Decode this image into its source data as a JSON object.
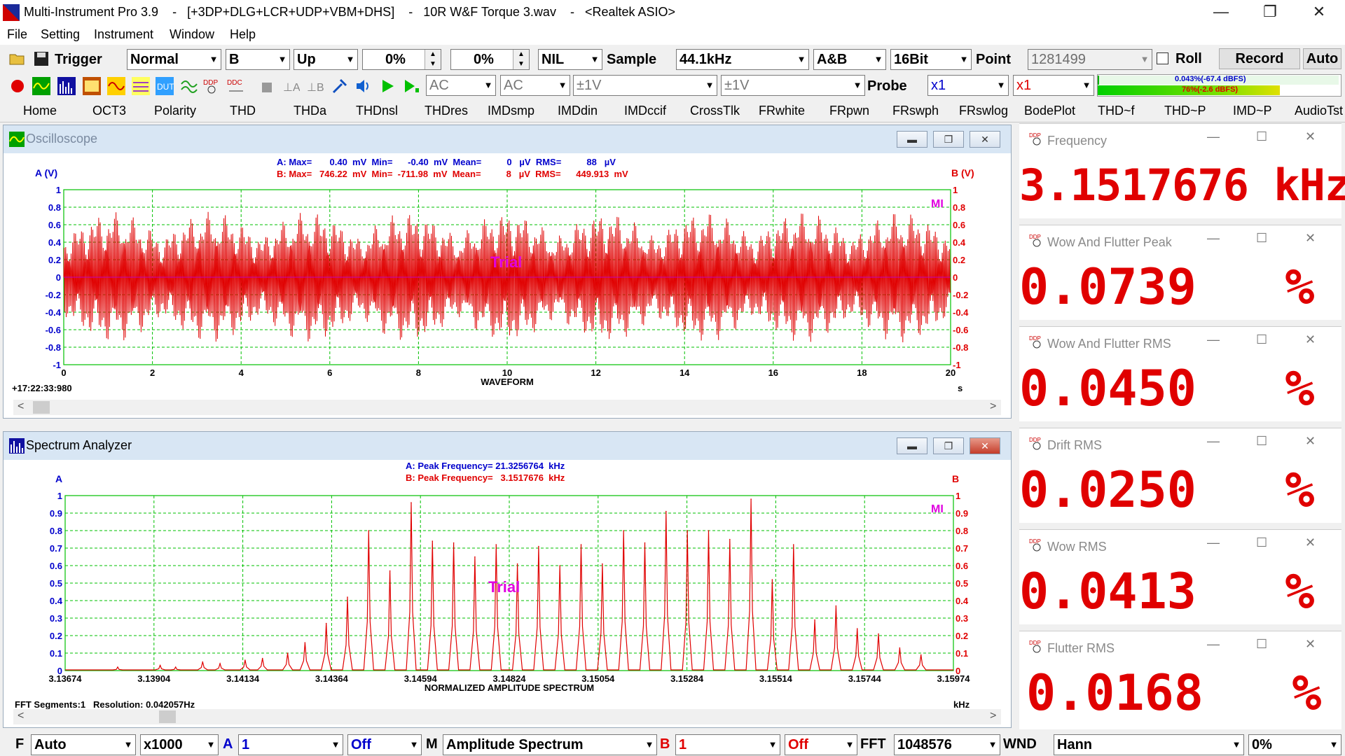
{
  "window": {
    "title": "Multi-Instrument Pro 3.9    -   [+3DP+DLG+LCR+UDP+VBM+DHS]    -   10R W&F Torque 3.wav    -   <Realtek ASIO>",
    "minimize": "—",
    "restore": "❐",
    "close": "✕"
  },
  "menu": [
    "File",
    "Setting",
    "Instrument",
    "Window",
    "Help"
  ],
  "toolbar1": {
    "trigger_label": "Trigger",
    "trigger_mode": "Normal",
    "trigger_channel": "B",
    "trigger_edge": "Up",
    "trigger_level": "0%",
    "trigger_delay": "0%",
    "nil": "NIL",
    "sample_label": "Sample",
    "sample_rate": "44.1kHz",
    "channels": "A&B",
    "bits": "16Bit",
    "point_label": "Point",
    "points": "1281499",
    "roll_label": "Roll",
    "record_label": "Record",
    "auto_label": "Auto"
  },
  "toolbar2": {
    "coupling_a": "AC",
    "coupling_b": "AC",
    "range_a": "±1V",
    "range_b": "±1V",
    "probe_label": "Probe",
    "probe_a": "x1",
    "probe_b": "x1",
    "level_a": "0.043%(-67.4 dBFS)",
    "level_b": "76%(-2.6 dBFS)"
  },
  "tabs": [
    "Home",
    "OCT3",
    "Polarity",
    "THD",
    "THDa",
    "THDnsl",
    "THDres",
    "IMDsmp",
    "IMDdin",
    "IMDccif",
    "CrossTlk",
    "FRwhite",
    "FRpwn",
    "FRswph",
    "FRswlog",
    "BodePlot",
    "THD~f",
    "THD~P",
    "IMD~P",
    "AudioTst"
  ],
  "oscilloscope": {
    "title": "Oscilloscope",
    "stats_a": "A: Max=       0.40  mV  Min=      -0.40  mV  Mean=          0   µV  RMS=          88   µV",
    "stats_b": "B: Max=   746.22  mV  Min=  -711.98  mV  Mean=          8   µV  RMS=      449.913  mV",
    "left_axis": "A (V)",
    "right_axis": "B (V)",
    "timestamp": "+17:22:33:980",
    "x_unit": "s",
    "watermark": "Trial",
    "mi_logo": "MI"
  },
  "spectrum": {
    "title": "Spectrum Analyzer",
    "peak_a": "A: Peak Frequency= 21.3256764  kHz",
    "peak_b": "B: Peak Frequency=   3.1517676  kHz",
    "left_axis": "A",
    "right_axis": "B",
    "x_unit": "kHz",
    "fft_info": "FFT Segments:1   Resolution: 0.042057Hz",
    "watermark": "Trial",
    "mi_logo": "MI"
  },
  "meters": [
    {
      "title": "Frequency",
      "value": "3.1517676 kHz"
    },
    {
      "title": "Wow And Flutter Peak",
      "value": "0.0739   %"
    },
    {
      "title": "Wow And Flutter RMS",
      "value": "0.0450   %"
    },
    {
      "title": "Drift RMS",
      "value": "0.0250   %"
    },
    {
      "title": "Wow RMS",
      "value": "0.0413   %"
    },
    {
      "title": "Flutter RMS",
      "value": "0.0168   %"
    }
  ],
  "bottombar": {
    "f_label": "F",
    "f_mode": "Auto",
    "zoom": "x1000",
    "a_label": "A",
    "a_value": "1",
    "a_state": "Off",
    "m_label": "M",
    "m_mode": "Amplitude Spectrum",
    "b_label": "B",
    "b_value": "1",
    "b_state": "Off",
    "fft_label": "FFT",
    "fft_size": "1048576",
    "wnd_label": "WND",
    "window_func": "Hann",
    "overlap": "0%"
  },
  "colors": {
    "trace": "#e00000",
    "grid": "#00c000",
    "a_text": "#0000cc",
    "b_text": "#e00000",
    "watermark": "#e000e0"
  },
  "chart_data": [
    {
      "type": "line",
      "xlabel": "WAVEFORM",
      "ylabel": "A (V)",
      "x_ticks": [
        "0",
        "2",
        "4",
        "6",
        "8",
        "10",
        "12",
        "14",
        "16",
        "18",
        "20"
      ],
      "y_ticks": [
        "1",
        "0.8",
        "0.6",
        "0.4",
        "0.2",
        "0",
        "-0.2",
        "-0.4",
        "-0.6",
        "-0.8",
        "-1"
      ],
      "xlim": [
        0,
        20
      ],
      "ylim": [
        -1,
        1
      ],
      "grid": true,
      "series": [
        {
          "name": "B",
          "peak_amplitude": 0.75,
          "envelope_min_amplitude": 0.15,
          "envelope_periods": 9
        }
      ]
    },
    {
      "type": "line",
      "xlabel": "NORMALIZED AMPLITUDE SPECTRUM",
      "x_ticks": [
        "3.13674",
        "3.13904",
        "3.14134",
        "3.14364",
        "3.14594",
        "3.14824",
        "3.15054",
        "3.15284",
        "3.15514",
        "3.15744",
        "3.15974"
      ],
      "y_ticks": [
        "1",
        "0.9",
        "0.8",
        "0.7",
        "0.6",
        "0.5",
        "0.4",
        "0.3",
        "0.2",
        "0.1",
        "0"
      ],
      "xlim": [
        3.13674,
        3.15974
      ],
      "ylim": [
        0,
        1
      ],
      "grid": true,
      "series": [
        {
          "name": "B",
          "peaks_x": [
            3.1381,
            3.1392,
            3.1403,
            3.1414,
            3.1425,
            3.1435,
            3.1446,
            3.1457,
            3.1468,
            3.1479,
            3.149,
            3.1501,
            3.1512,
            3.1523,
            3.1534,
            3.1545,
            3.1556,
            3.1567,
            3.1578,
            3.1589,
            3.14515,
            3.14625,
            3.14735,
            3.14845,
            3.14955,
            3.15065,
            3.15175,
            3.15285,
            3.15395,
            3.15505,
            3.14405,
            3.14295,
            3.14185,
            3.14075,
            3.15615,
            3.15725,
            3.1396,
            3.15835
          ],
          "peaks_y": [
            0.02,
            0.03,
            0.05,
            0.06,
            0.1,
            0.27,
            0.8,
            0.96,
            0.73,
            0.72,
            0.71,
            0.72,
            0.8,
            0.91,
            0.8,
            0.98,
            0.72,
            0.37,
            0.21,
            0.09,
            0.57,
            0.74,
            0.65,
            0.61,
            0.6,
            0.61,
            0.73,
            0.8,
            0.75,
            0.52,
            0.42,
            0.16,
            0.07,
            0.04,
            0.29,
            0.24,
            0.02,
            0.13
          ]
        }
      ]
    }
  ]
}
